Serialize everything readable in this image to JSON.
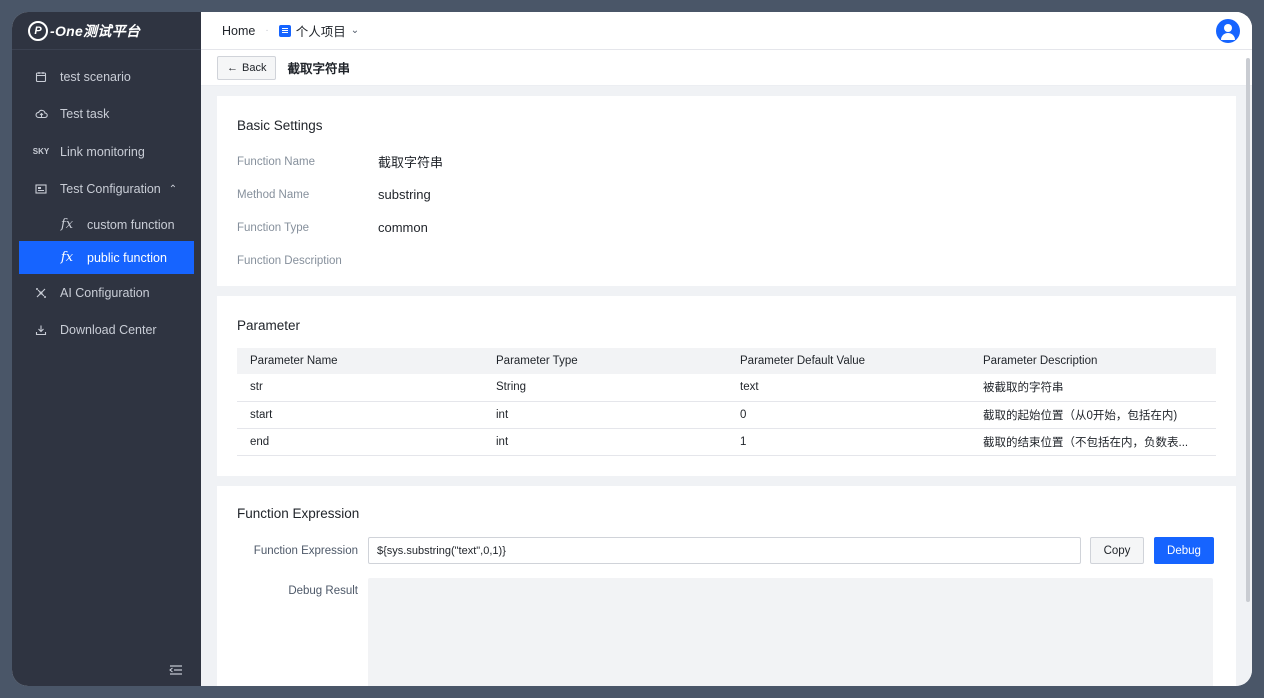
{
  "app": {
    "logo_text": "-One测试平台",
    "logo_letter": "P"
  },
  "sidebar": {
    "items": [
      {
        "label": "test scenario",
        "icon": "calendar-icon"
      },
      {
        "label": "Test task",
        "icon": "cloud-icon"
      },
      {
        "label": "Link monitoring",
        "icon": "sky-icon"
      },
      {
        "label": "Test Configuration",
        "icon": "config-icon"
      },
      {
        "label": "custom function",
        "icon": "fx-icon"
      },
      {
        "label": "public function",
        "icon": "fx-icon"
      },
      {
        "label": "AI Configuration",
        "icon": "ai-icon"
      },
      {
        "label": "Download Center",
        "icon": "download-icon"
      }
    ],
    "icon_glyphs": {
      "fx": "fx",
      "chevron": "⌃",
      "collapse": "⇤"
    }
  },
  "header": {
    "home": "Home",
    "separator": "·",
    "project": "个人项目",
    "chevron": "⌄"
  },
  "subheader": {
    "back_label": "Back",
    "back_arrow": "←",
    "title": "截取字符串"
  },
  "basic": {
    "title": "Basic Settings",
    "fields": [
      {
        "label": "Function Name",
        "value": "截取字符串"
      },
      {
        "label": "Method Name",
        "value": "substring"
      },
      {
        "label": "Function Type",
        "value": "common"
      },
      {
        "label": "Function Description",
        "value": ""
      }
    ]
  },
  "params": {
    "title": "Parameter",
    "columns": [
      "Parameter Name",
      "Parameter Type",
      "Parameter Default Value",
      "Parameter Description"
    ],
    "rows": [
      [
        "str",
        "String",
        "text",
        "被截取的字符串"
      ],
      [
        "start",
        "int",
        "0",
        "截取的起始位置（从0开始，包括在内)"
      ],
      [
        "end",
        "int",
        "1",
        "截取的结束位置（不包括在内，负数表..."
      ]
    ]
  },
  "expression": {
    "title": "Function Expression",
    "label": "Function Expression",
    "value": "${sys.substring(\"text\",0,1)}",
    "copy_label": "Copy",
    "debug_label": "Debug",
    "result_label": "Debug Result"
  },
  "colors": {
    "accent": "#1664ff",
    "sidebar_bg": "#2f3441"
  }
}
